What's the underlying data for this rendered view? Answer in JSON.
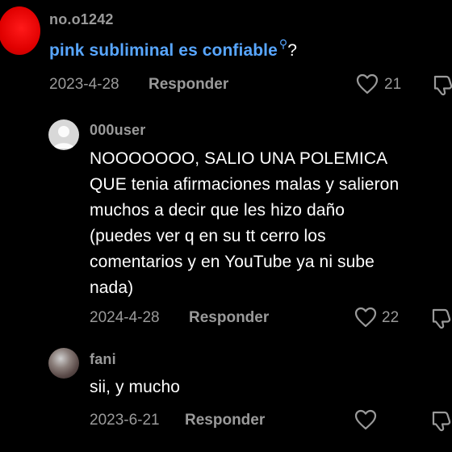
{
  "comments": [
    {
      "username": "no.o1242",
      "text_link": "pink subliminal es confiable",
      "search_glyph": "⚲",
      "text_suffix": "?",
      "date": "2023-4-28",
      "reply_label": "Responder",
      "likes": "21",
      "avatar_color": "#e00000"
    }
  ],
  "replies": [
    {
      "username": "000user",
      "lines": [
        "NOOOOOOO, SALIO UNA POLEMICA",
        "QUE tenia afirmaciones malas y salieron",
        "muchos a decir que les hizo daño",
        "(puedes ver q en su tt cerro los",
        "comentarios y en YouTube ya ni sube",
        "nada)"
      ],
      "date": "2024-4-28",
      "reply_label": "Responder",
      "likes": "22"
    },
    {
      "username": "fani",
      "lines": [
        "sii, y mucho"
      ],
      "date": "2023-6-21",
      "reply_label": "Responder",
      "likes": ""
    }
  ],
  "colors": {
    "background": "#000000",
    "muted_text": "#9a9a9a",
    "link": "#58a6ff",
    "text": "#ffffff"
  },
  "icons": {
    "like": "heart-icon",
    "dislike": "thumbs-down-icon",
    "search": "search-icon"
  }
}
